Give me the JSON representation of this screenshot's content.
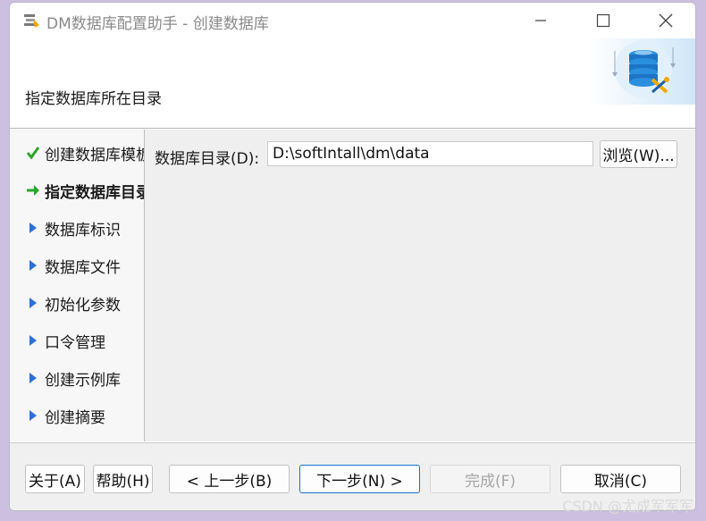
{
  "window": {
    "title": "DM数据库配置助手 - 创建数据库"
  },
  "header": {
    "title": "指定数据库所在目录"
  },
  "steps": [
    {
      "label": "创建数据库模板",
      "state": "done",
      "icon": "check-icon"
    },
    {
      "label": "指定数据库目录",
      "state": "current",
      "icon": "arrow-right-icon"
    },
    {
      "label": "数据库标识",
      "state": "pending",
      "icon": "triangle-right-icon"
    },
    {
      "label": "数据库文件",
      "state": "pending",
      "icon": "triangle-right-icon"
    },
    {
      "label": "初始化参数",
      "state": "pending",
      "icon": "triangle-right-icon"
    },
    {
      "label": "口令管理",
      "state": "pending",
      "icon": "triangle-right-icon"
    },
    {
      "label": "创建示例库",
      "state": "pending",
      "icon": "triangle-right-icon"
    },
    {
      "label": "创建摘要",
      "state": "pending",
      "icon": "triangle-right-icon"
    }
  ],
  "main": {
    "dir_label": "数据库目录(D):",
    "dir_value": "D:\\softIntall\\dm\\data",
    "browse_label": "浏览(W)..."
  },
  "footer": {
    "about": "关于(A)",
    "help": "帮助(H)",
    "prev": "< 上一步(B)",
    "next": "下一步(N) >",
    "finish": "完成(F)",
    "cancel": "取消(C)"
  },
  "watermark": "CSDN @尤成军军军",
  "colors": {
    "check": "#2aa52a",
    "arrow": "#2aa52a",
    "triangle": "#2f6fd6",
    "primary_border": "#1d6fd0"
  }
}
